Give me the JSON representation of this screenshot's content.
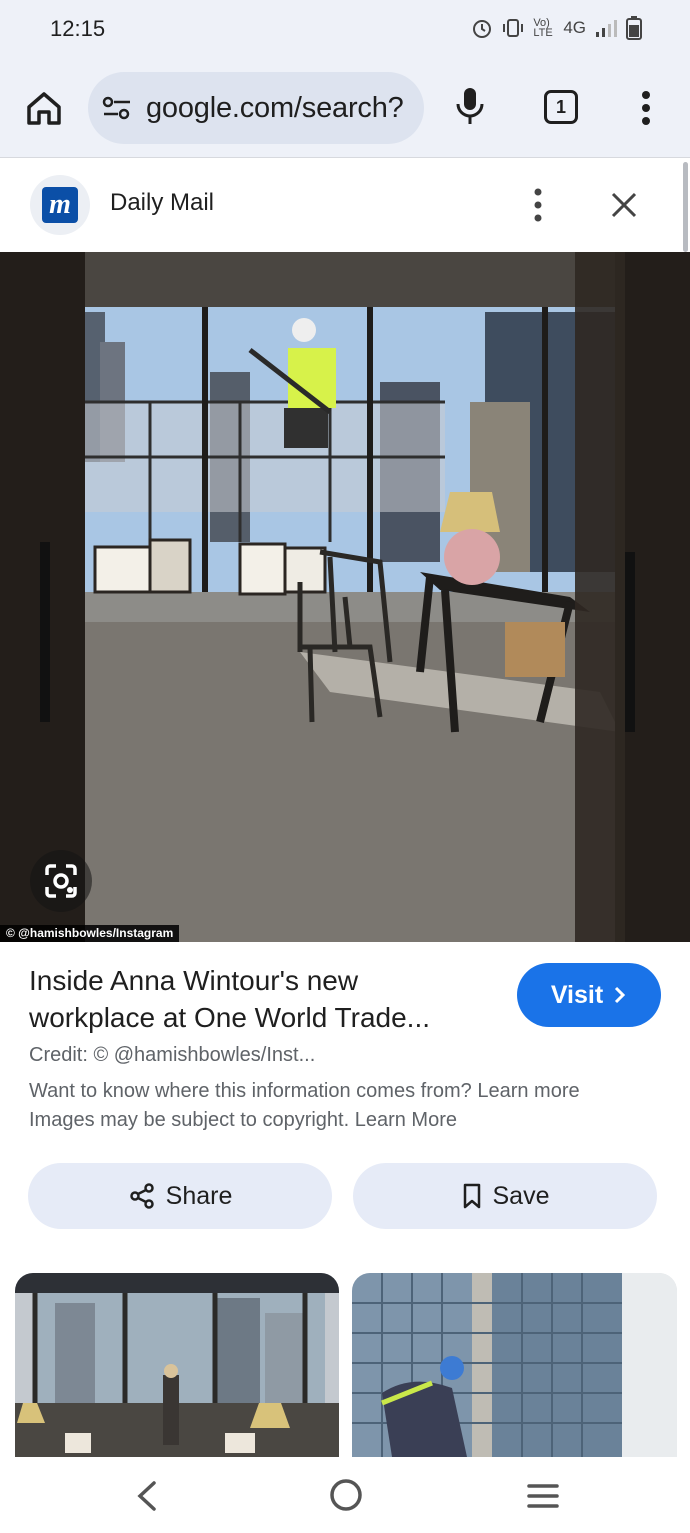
{
  "status_bar": {
    "time": "12:15",
    "network": "4G",
    "volte": "Vo) LTE"
  },
  "browser": {
    "url": "google.com/search?",
    "tab_count": "1"
  },
  "source": {
    "name": "Daily Mail",
    "logo_letter": "m"
  },
  "image": {
    "credit_overlay": "© @hamishbowles/Instagram"
  },
  "result": {
    "title": "Inside Anna Wintour's new workplace at One World Trade...",
    "visit_label": "Visit",
    "credit": "Credit: © @hamishbowles/Inst...",
    "info": "Want to know where this information comes from? Learn more",
    "copyright": "Images may be subject to copyright. Learn More"
  },
  "actions": {
    "share_label": "Share",
    "save_label": "Save"
  },
  "colors": {
    "accent": "#1a73e8",
    "toolbar_bg": "#eef1f8",
    "pill_bg": "#e6ebf7",
    "brand": "#0b4fa7"
  },
  "icons": [
    "home-icon",
    "tune-icon",
    "mic-icon",
    "tabs-icon",
    "more-vert-icon",
    "close-icon",
    "lens-icon",
    "share-icon",
    "bookmark-icon",
    "chevron-right-icon",
    "back-icon",
    "home-circle-icon",
    "recents-icon"
  ]
}
